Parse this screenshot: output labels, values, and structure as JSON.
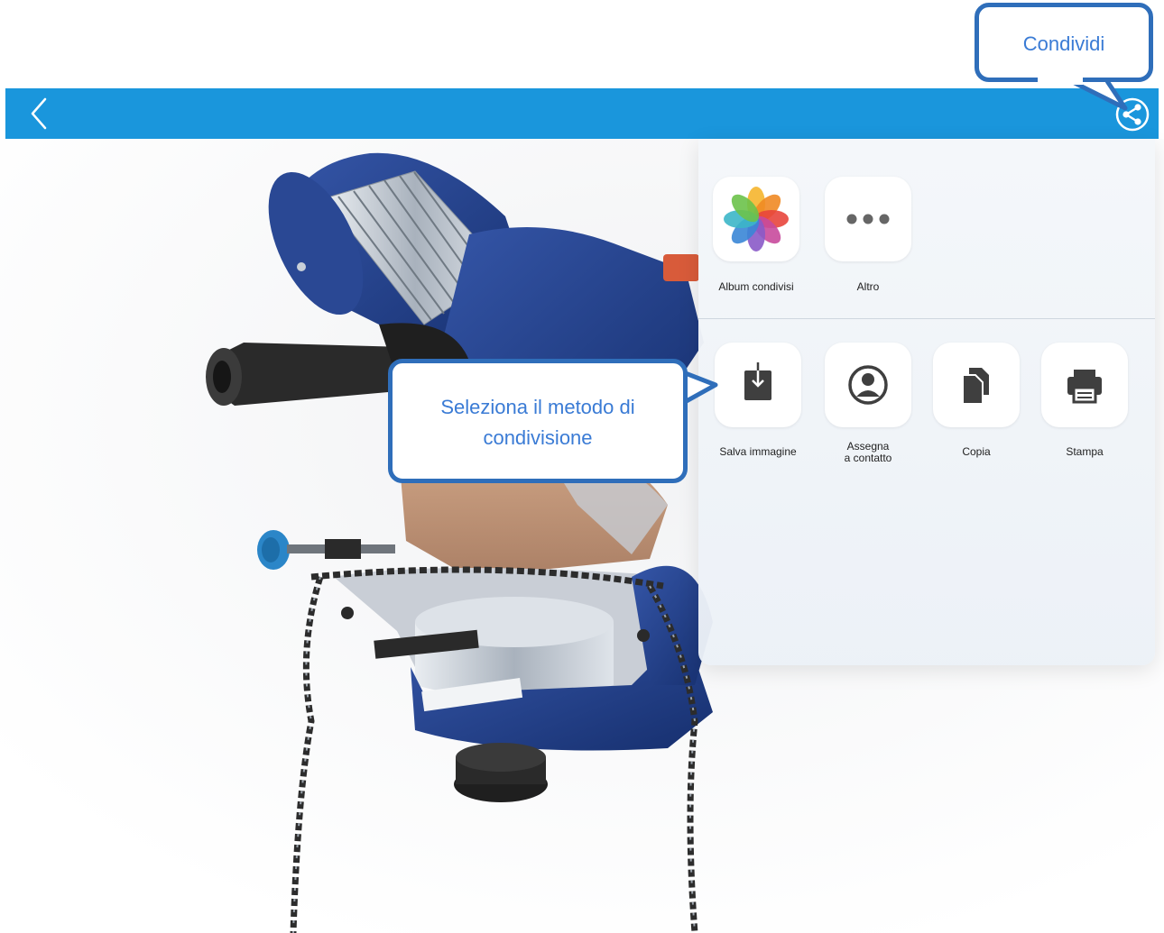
{
  "callouts": {
    "share": "Condividi",
    "method_line1": "Seleziona il metodo di",
    "method_line2": "condivisione"
  },
  "topbar": {
    "color": "#1a96dc",
    "back_icon": "chevron-left-icon",
    "share_icon": "share-icon"
  },
  "share_sheet": {
    "row1": [
      {
        "label": "Album condivisi",
        "icon": "photos-app-icon"
      },
      {
        "label": "Altro",
        "icon": "more-icon"
      }
    ],
    "row2": [
      {
        "label": "Salva immagine",
        "icon": "save-image-icon"
      },
      {
        "label_line1": "Assegna",
        "label_line2": "a contatto",
        "icon": "contact-icon"
      },
      {
        "label": "Copia",
        "icon": "copy-icon"
      },
      {
        "label": "Stampa",
        "icon": "print-icon"
      }
    ]
  },
  "colors": {
    "accent": "#1a96dc",
    "callout_border": "#2f6eba",
    "callout_text": "#3a7bd5",
    "machine_blue": "#1f3f8c"
  }
}
